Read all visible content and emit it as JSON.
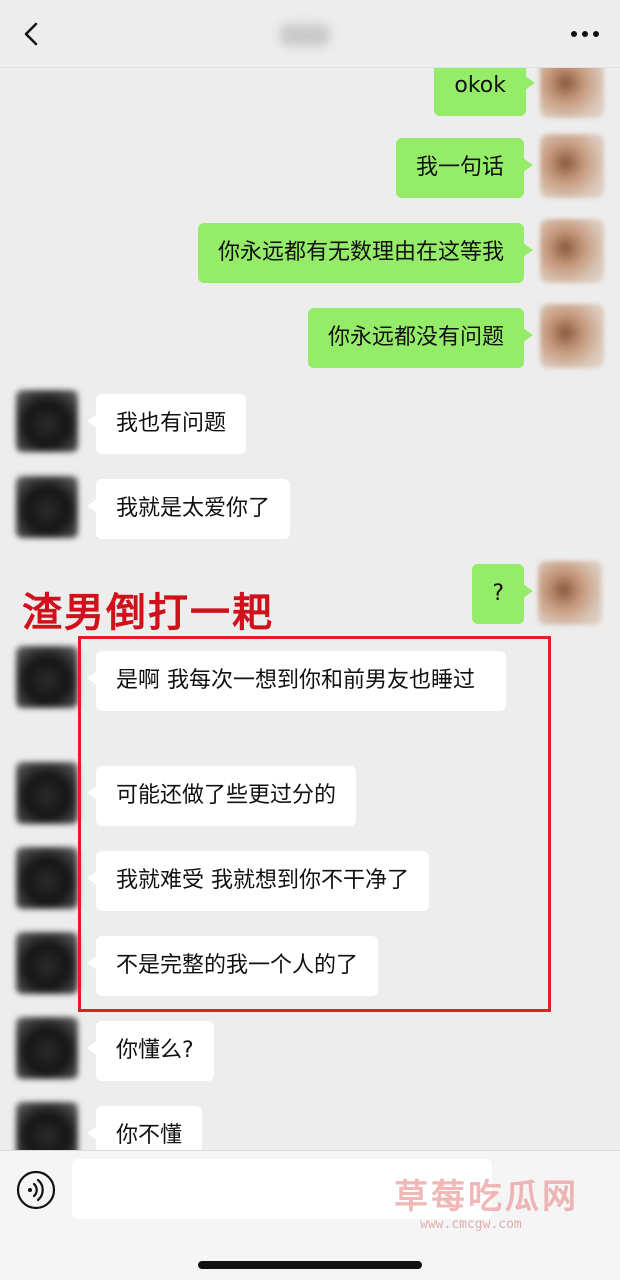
{
  "header": {
    "contact_name_blurred": "",
    "back_icon": "chevron-left-icon",
    "more_icon": "more-dots-icon"
  },
  "messages": [
    {
      "from": "self",
      "text": "okok"
    },
    {
      "from": "self",
      "text": "我一句话"
    },
    {
      "from": "self",
      "text": "你永远都有无数理由在这等我"
    },
    {
      "from": "self",
      "text": "你永远都没有问题"
    },
    {
      "from": "other",
      "text": "我也有问题"
    },
    {
      "from": "other",
      "text": "我就是太爱你了"
    },
    {
      "from": "self",
      "text": "?"
    },
    {
      "from": "other",
      "text": "是啊 我每次一想到你和前男友也睡过"
    },
    {
      "from": "other",
      "text": "可能还做了些更过分的"
    },
    {
      "from": "other",
      "text": "我就难受 我就想到你不干净了"
    },
    {
      "from": "other",
      "text": "不是完整的我一个人的了"
    },
    {
      "from": "other",
      "text": "你懂么?"
    },
    {
      "from": "other",
      "text": "你不懂"
    }
  ],
  "annotation": {
    "caption": "渣男倒打一耙",
    "highlight_color": "#e01e24"
  },
  "input_bar": {
    "voice_icon": "voice-icon",
    "placeholder": ""
  },
  "watermark": {
    "text": "草莓吃瓜网",
    "url": "www.cmcgw.com"
  },
  "colors": {
    "self_bubble": "#95ec69",
    "other_bubble": "#ffffff",
    "background": "#ededed"
  }
}
